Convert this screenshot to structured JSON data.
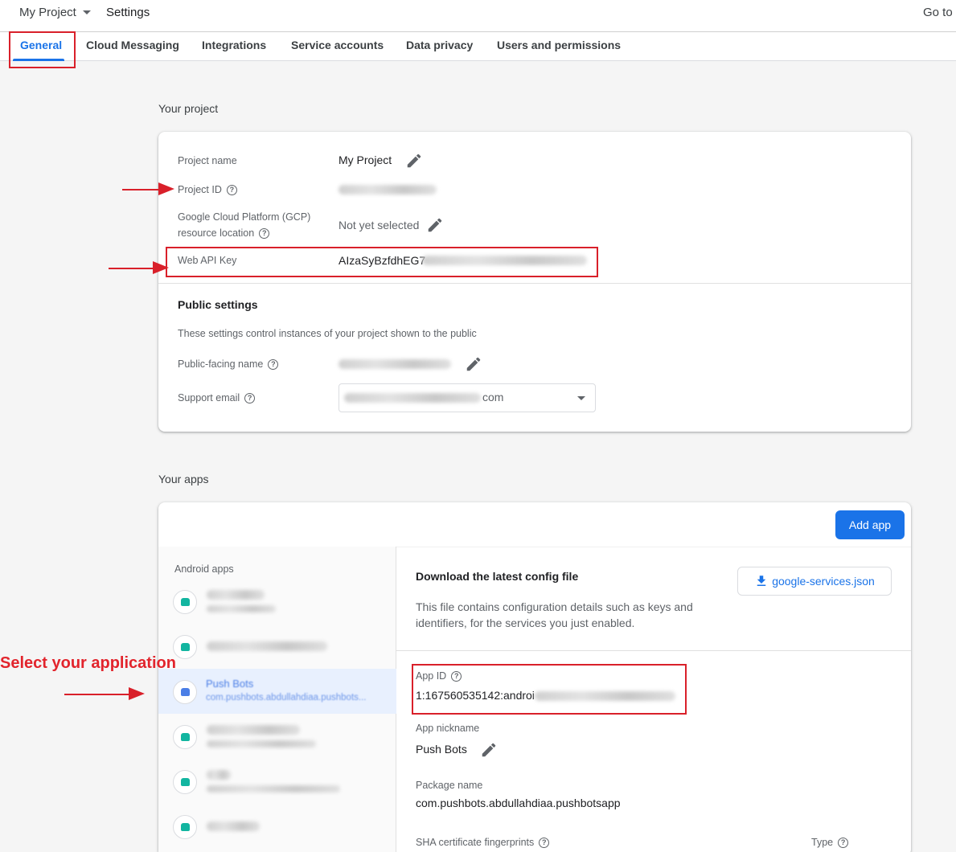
{
  "topbar": {
    "project_name": "My Project",
    "settings_title": "Settings",
    "goto_label": "Go to c"
  },
  "tabs": [
    {
      "label": "General",
      "active": true
    },
    {
      "label": "Cloud Messaging"
    },
    {
      "label": "Integrations"
    },
    {
      "label": "Service accounts"
    },
    {
      "label": "Data privacy"
    },
    {
      "label": "Users and permissions"
    }
  ],
  "your_project": {
    "section_title": "Your project",
    "project_name_label": "Project name",
    "project_name_value": "My Project",
    "project_id_label": "Project ID",
    "gcp_label_line1": "Google Cloud Platform (GCP)",
    "gcp_label_line2": "resource location",
    "gcp_value": "Not yet selected",
    "web_api_key_label": "Web API Key",
    "web_api_key_value": "AIzaSyBzfdhEG7"
  },
  "public_settings": {
    "title": "Public settings",
    "description": "These settings control instances of your project shown to the public",
    "public_name_label": "Public-facing name",
    "support_email_label": "Support email",
    "support_email_suffix": "com"
  },
  "your_apps": {
    "section_title": "Your apps",
    "add_app_label": "Add app",
    "android_apps_label": "Android apps",
    "selected_app_name": "Push Bots",
    "selected_app_package": "com.pushbots.abdullahdiaa.pushbots..."
  },
  "config": {
    "title": "Download the latest config file",
    "download_label": "google-services.json",
    "description_line1": "This file contains configuration details such as keys and",
    "description_line2": "identifiers, for the services you just enabled.",
    "app_id_label": "App ID",
    "app_id_value": "1:167560535142:androi",
    "app_nickname_label": "App nickname",
    "app_nickname_value": "Push Bots",
    "package_name_label": "Package name",
    "package_name_value": "com.pushbots.abdullahdiaa.pushbotsapp",
    "sha_label": "SHA certificate fingerprints",
    "type_label": "Type"
  },
  "annotation": {
    "text": "Select your application"
  },
  "colors": {
    "accent": "#1a73e8",
    "annotation_red": "#d9202a"
  },
  "icons": [
    "chevron-down-icon",
    "help-icon",
    "pencil-icon",
    "download-icon",
    "android-app-icon",
    "arrow-icon"
  ]
}
